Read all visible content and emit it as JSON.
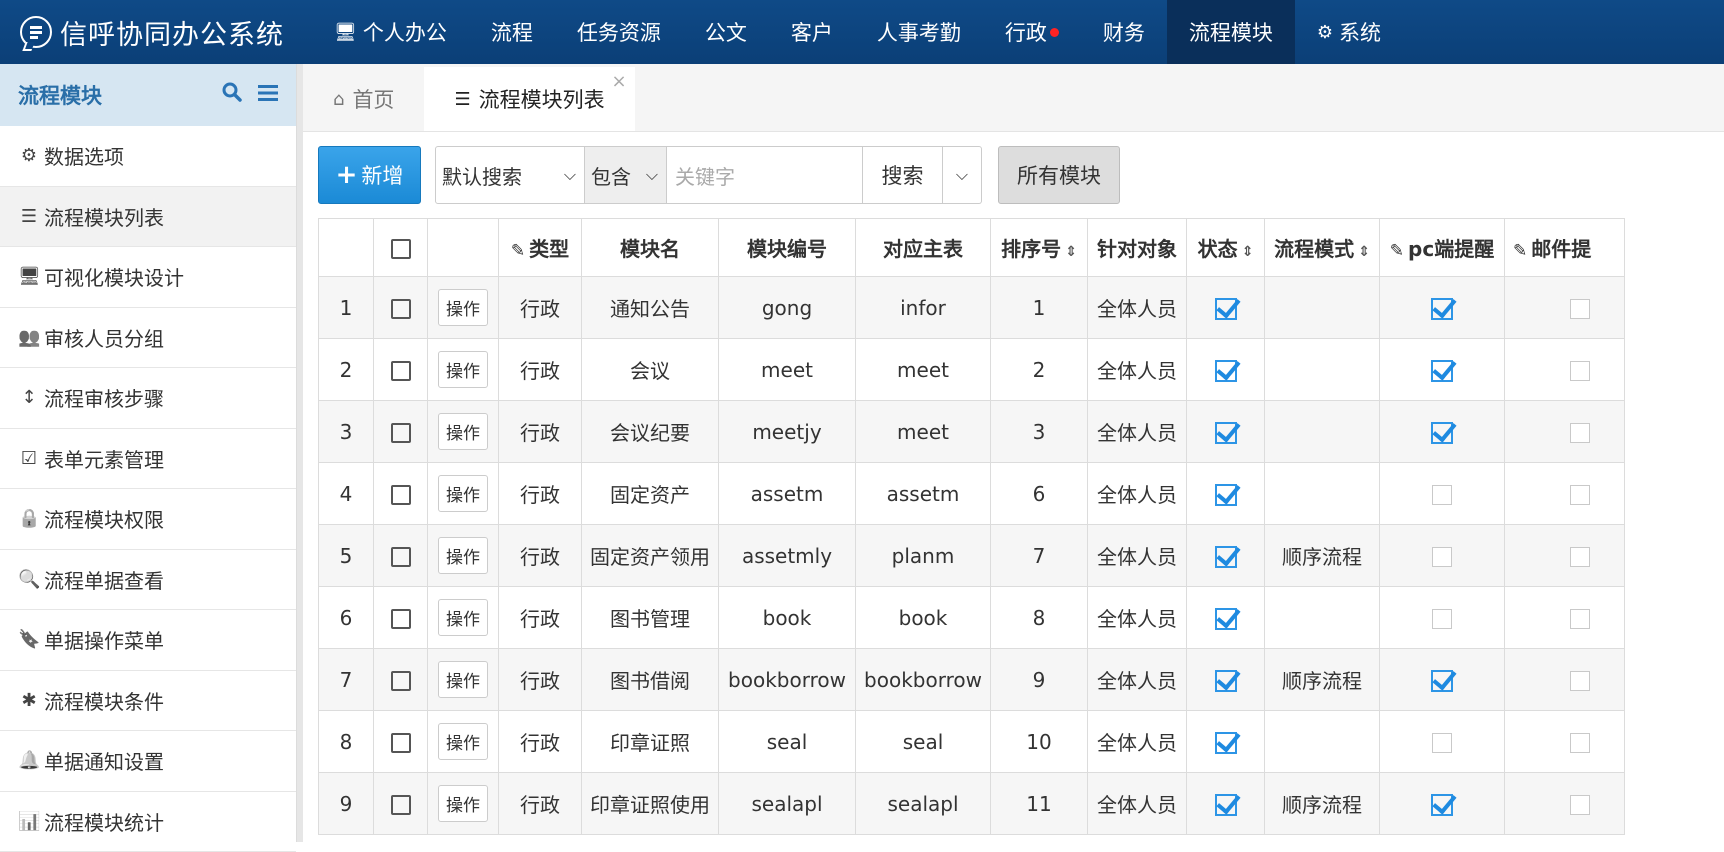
{
  "app": {
    "title": "信呼协同办公系统",
    "logo_icon": "chat-bubble-icon"
  },
  "nav": [
    {
      "label": "个人办公",
      "icon": "monitor-icon",
      "active": false,
      "badge": false
    },
    {
      "label": "流程",
      "active": false,
      "badge": false
    },
    {
      "label": "任务资源",
      "active": false,
      "badge": false
    },
    {
      "label": "公文",
      "active": false,
      "badge": false
    },
    {
      "label": "客户",
      "active": false,
      "badge": false
    },
    {
      "label": "人事考勤",
      "active": false,
      "badge": false
    },
    {
      "label": "行政",
      "active": false,
      "badge": true
    },
    {
      "label": "财务",
      "active": false,
      "badge": false
    },
    {
      "label": "流程模块",
      "active": true,
      "badge": false
    },
    {
      "label": "系统",
      "icon": "gear-icon",
      "active": false,
      "badge": false
    }
  ],
  "sidebar": {
    "title": "流程模块",
    "items": [
      {
        "label": "数据选项",
        "icon": "gear-icon",
        "active": false
      },
      {
        "label": "流程模块列表",
        "icon": "list-icon",
        "active": true
      },
      {
        "label": "可视化模块设计",
        "icon": "monitor-icon",
        "active": false
      },
      {
        "label": "审核人员分组",
        "icon": "users-icon",
        "active": false
      },
      {
        "label": "流程审核步骤",
        "icon": "vertical-arrows-icon",
        "active": false
      },
      {
        "label": "表单元素管理",
        "icon": "check-square-icon",
        "active": false
      },
      {
        "label": "流程模块权限",
        "icon": "lock-icon",
        "active": false
      },
      {
        "label": "流程单据查看",
        "icon": "search-icon",
        "active": false
      },
      {
        "label": "单据操作菜单",
        "icon": "bookmark-icon",
        "active": false
      },
      {
        "label": "流程模块条件",
        "icon": "asterisk-icon",
        "active": false
      },
      {
        "label": "单据通知设置",
        "icon": "bell-icon",
        "active": false
      },
      {
        "label": "流程模块统计",
        "icon": "bar-chart-icon",
        "active": false
      }
    ]
  },
  "tabs": [
    {
      "label": "首页",
      "icon": "home-icon",
      "active": false
    },
    {
      "label": "流程模块列表",
      "icon": "list-icon",
      "active": true
    }
  ],
  "toolbar": {
    "add_label": "新增",
    "search_type": "默认搜索",
    "match_mode": "包含",
    "keyword_placeholder": "关键字",
    "search_label": "搜索",
    "all_modules_label": "所有模块"
  },
  "table": {
    "headers": [
      "",
      "",
      "",
      "类型",
      "模块名",
      "模块编号",
      "对应主表",
      "排序号",
      "针对对象",
      "状态",
      "流程模式",
      "pc端提醒",
      "邮件提"
    ],
    "rows": [
      {
        "no": "1",
        "type": "行政",
        "name": "通知公告",
        "num": "gong",
        "table": "infor",
        "sort": "1",
        "target": "全体人员",
        "status": true,
        "mode": "",
        "pc": true,
        "mail": false
      },
      {
        "no": "2",
        "type": "行政",
        "name": "会议",
        "num": "meet",
        "table": "meet",
        "sort": "2",
        "target": "全体人员",
        "status": true,
        "mode": "",
        "pc": true,
        "mail": false
      },
      {
        "no": "3",
        "type": "行政",
        "name": "会议纪要",
        "num": "meetjy",
        "table": "meet",
        "sort": "3",
        "target": "全体人员",
        "status": true,
        "mode": "",
        "pc": true,
        "mail": false
      },
      {
        "no": "4",
        "type": "行政",
        "name": "固定资产",
        "num": "assetm",
        "table": "assetm",
        "sort": "6",
        "target": "全体人员",
        "status": true,
        "mode": "",
        "pc": false,
        "mail": false
      },
      {
        "no": "5",
        "type": "行政",
        "name": "固定资产领用",
        "num": "assetmly",
        "table": "planm",
        "sort": "7",
        "target": "全体人员",
        "status": true,
        "mode": "顺序流程",
        "pc": false,
        "mail": false
      },
      {
        "no": "6",
        "type": "行政",
        "name": "图书管理",
        "num": "book",
        "table": "book",
        "sort": "8",
        "target": "全体人员",
        "status": true,
        "mode": "",
        "pc": false,
        "mail": false
      },
      {
        "no": "7",
        "type": "行政",
        "name": "图书借阅",
        "num": "bookborrow",
        "table": "bookborrow",
        "sort": "9",
        "target": "全体人员",
        "status": true,
        "mode": "顺序流程",
        "pc": true,
        "mail": false
      },
      {
        "no": "8",
        "type": "行政",
        "name": "印章证照",
        "num": "seal",
        "table": "seal",
        "sort": "10",
        "target": "全体人员",
        "status": true,
        "mode": "",
        "pc": false,
        "mail": false
      },
      {
        "no": "9",
        "type": "行政",
        "name": "印章证照使用",
        "num": "sealapl",
        "table": "sealapl",
        "sort": "11",
        "target": "全体人员",
        "status": true,
        "mode": "顺序流程",
        "pc": true,
        "mail": false
      }
    ],
    "op_label": "操作"
  },
  "colors": {
    "topbar": "#0f4a87",
    "nav_active": "#0a2f5a",
    "sidebar_header": "#d6e6f2",
    "primary": "#2a95e0",
    "badge": "#ff2323"
  }
}
